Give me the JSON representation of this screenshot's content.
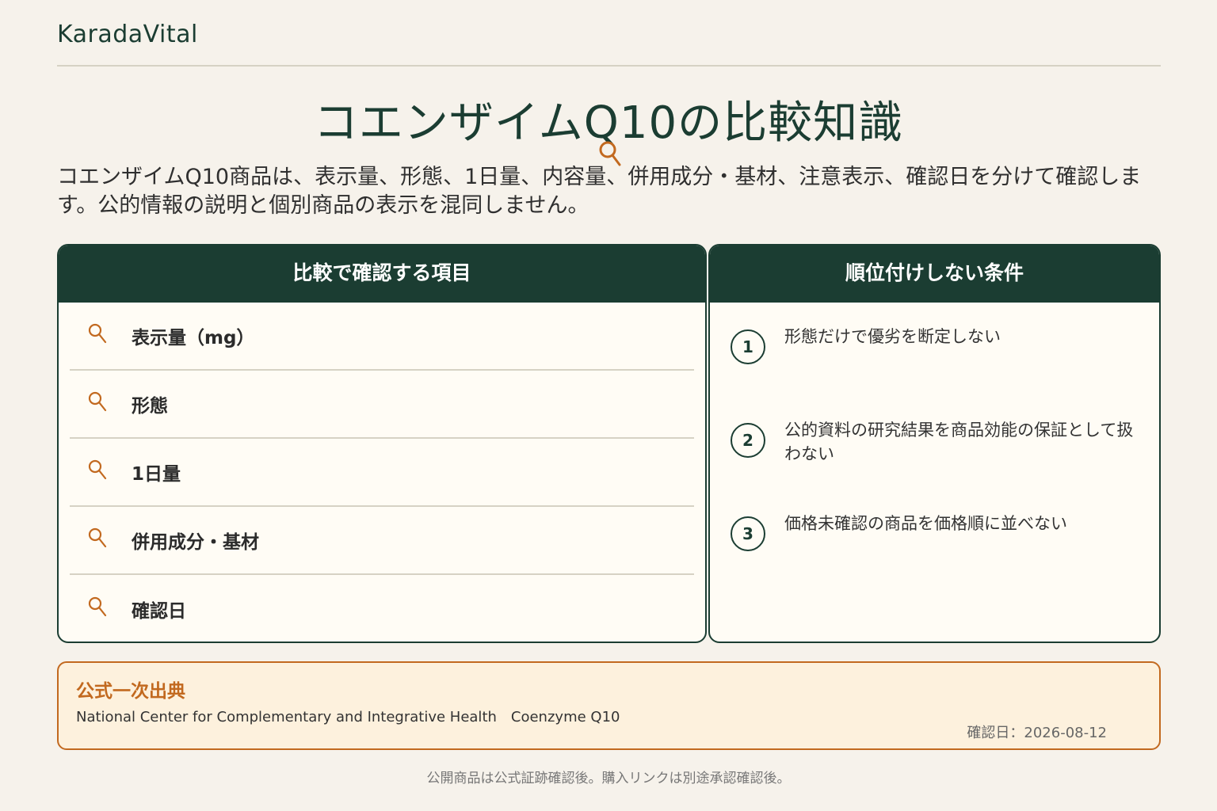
{
  "brand": "KaradaVital",
  "title": "コエンザイムQ10の比較知識",
  "intro": "コエンザイムQ10商品は、表示量、形態、1日量、内容量、併用成分・基材、注意表示、確認日を分けて確認します。公的情報の説明と個別商品の表示を混同しません。",
  "check_panel": {
    "heading": "比較で確認する項目",
    "items": [
      {
        "label": "表示量（mg）",
        "icon": "magnifier-icon"
      },
      {
        "label": "形態",
        "icon": "magnifier-icon"
      },
      {
        "label": "1日量",
        "icon": "magnifier-icon"
      },
      {
        "label": "併用成分・基材",
        "icon": "magnifier-icon"
      },
      {
        "label": "確認日",
        "icon": "magnifier-icon"
      }
    ]
  },
  "condition_panel": {
    "heading": "順位付けしない条件",
    "items": [
      {
        "num": "1",
        "text": "形態だけで優劣を断定しない"
      },
      {
        "num": "2",
        "text": "公的資料の研究結果を商品効能の保証として扱わない"
      },
      {
        "num": "3",
        "text": "価格未確認の商品を価格順に並べない"
      }
    ]
  },
  "source": {
    "heading": "公式一次出典",
    "text": "National Center for Complementary and Integrative Health　Coenzyme Q10",
    "date": "確認日：2026-08-12"
  },
  "footer": "公開商品は公式証跡確認後。購入リンクは別途承認確認後。",
  "colors": {
    "primary": "#1b3d32",
    "accent": "#c2691f",
    "background": "#f6f2eb"
  }
}
